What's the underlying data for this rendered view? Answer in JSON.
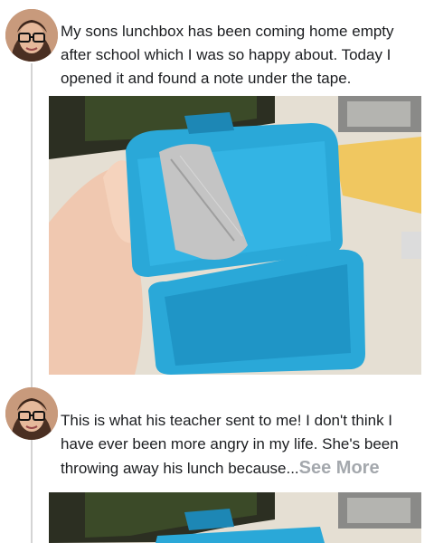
{
  "posts": [
    {
      "avatar_icon": "user-avatar-glasses",
      "text": "My sons lunchbox has been coming home empty after school which I was so happy about. Today I opened it and found a note under the tape.",
      "image_icon": "lunchbox-photo"
    },
    {
      "avatar_icon": "user-avatar-glasses",
      "text": "This is what his teacher sent to me! I don't think I have ever been more angry in my life. She's been throwing away his lunch because...",
      "see_more": "See More",
      "image_icon": "lunchbox-photo"
    }
  ],
  "colors": {
    "lunchbox": "#2aa8d8",
    "lunchbox_dark": "#1d87b5",
    "tape": "#bfbfbf",
    "text": "#1c1e21",
    "see_more": "#a4a8ad",
    "thread_line": "#d4d4d4"
  }
}
